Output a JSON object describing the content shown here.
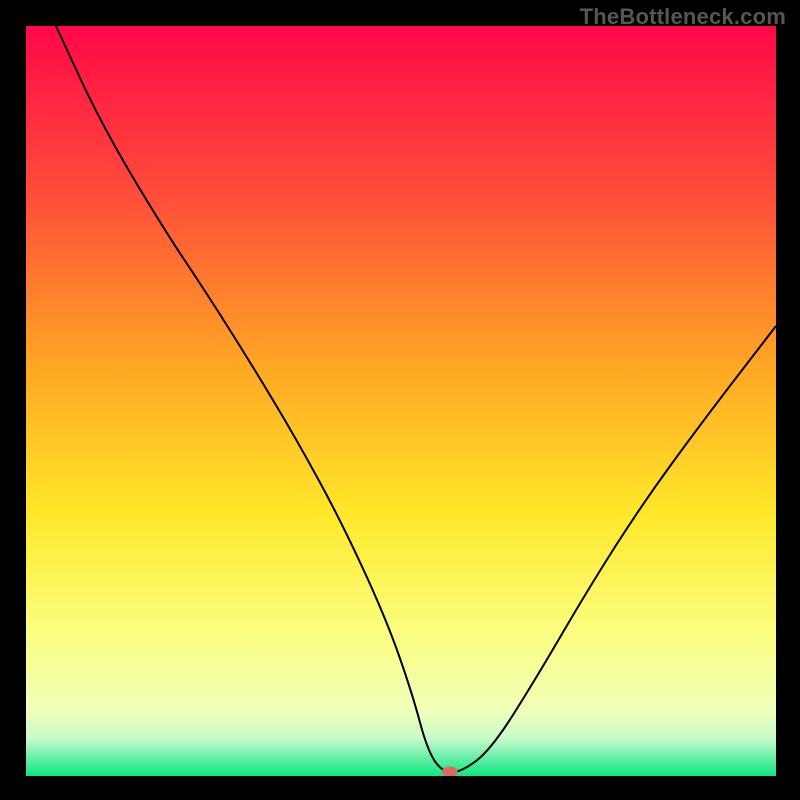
{
  "watermark": "TheBottleneck.com",
  "chart_data": {
    "type": "line",
    "title": "",
    "xlabel": "",
    "ylabel": "",
    "xlim": [
      0,
      100
    ],
    "ylim": [
      0,
      100
    ],
    "grid": false,
    "background_gradient": {
      "stops": [
        {
          "offset": 0,
          "color": "#ff0848"
        },
        {
          "offset": 22,
          "color": "#ff4b3a"
        },
        {
          "offset": 45,
          "color": "#ffa524"
        },
        {
          "offset": 65,
          "color": "#ffe82a"
        },
        {
          "offset": 80,
          "color": "#fbfd7a"
        },
        {
          "offset": 91,
          "color": "#f1ffb8"
        },
        {
          "offset": 95,
          "color": "#c9fbcb"
        },
        {
          "offset": 97,
          "color": "#7cf0b0"
        },
        {
          "offset": 100,
          "color": "#0de77f"
        }
      ]
    },
    "series": [
      {
        "name": "curve",
        "color": "#000000",
        "stroke_width": 2,
        "x": [
          4,
          10,
          18,
          24,
          30,
          36,
          42,
          48,
          51.5,
          53.5,
          55.5,
          58,
          62,
          68,
          75,
          82,
          90,
          100
        ],
        "y": [
          100,
          87,
          73.5,
          64.5,
          55,
          45,
          34,
          21,
          11,
          3.5,
          0.5,
          0.5,
          3.5,
          13,
          25,
          36,
          47,
          60
        ]
      }
    ],
    "marker": {
      "name": "min-marker",
      "x": 56.5,
      "y": 0.6,
      "color": "#e36464",
      "rx": 8,
      "ry": 5
    }
  }
}
